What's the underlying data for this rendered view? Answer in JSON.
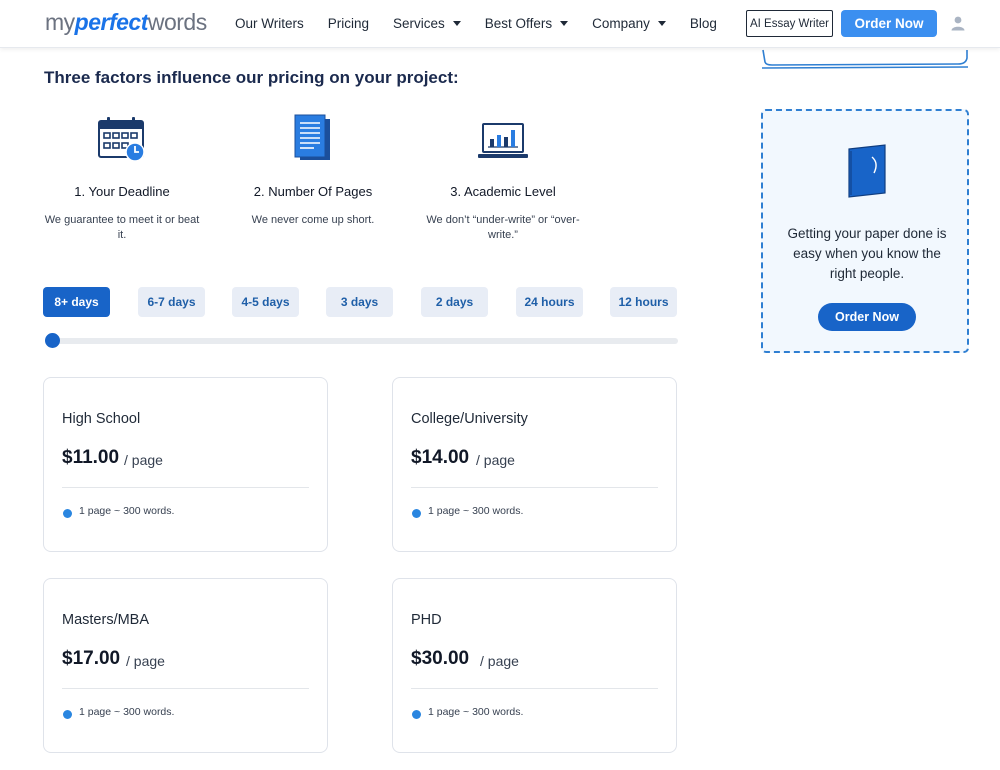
{
  "header": {
    "logo": {
      "part1": "my",
      "part2": "perfect",
      "part3": "words"
    },
    "nav": [
      {
        "label": "Our Writers",
        "dropdown": false
      },
      {
        "label": "Pricing",
        "dropdown": false
      },
      {
        "label": "Services",
        "dropdown": true
      },
      {
        "label": "Best Offers",
        "dropdown": true
      },
      {
        "label": "Company",
        "dropdown": true
      },
      {
        "label": "Blog",
        "dropdown": false
      }
    ],
    "ai_button": "AI Essay Writer",
    "order_button": "Order Now",
    "user_icon": "user-icon"
  },
  "main": {
    "title": "Three factors influence our pricing on your project:",
    "factors": [
      {
        "icon": "calendar-clock-icon",
        "title": "1. Your Deadline",
        "desc": "We guarantee to meet it or beat it."
      },
      {
        "icon": "document-pages-icon",
        "title": "2. Number Of Pages",
        "desc": "We never come up short."
      },
      {
        "icon": "laptop-chart-icon",
        "title": "3. Academic Level",
        "desc": "We don’t “under-write” or “over-write.”"
      }
    ],
    "deadlines": [
      "8+ days",
      "6-7 days",
      "4-5 days",
      "3 days",
      "2 days",
      "24 hours",
      "12 hours"
    ],
    "selected_deadline": "8+ days",
    "slider_value_fraction": 0,
    "cards": [
      {
        "level": "High School",
        "price": "$11.00",
        "unit": "/ page",
        "note": "1 page ~ 300 words."
      },
      {
        "level": "College/University",
        "price": "$14.00",
        "unit": "/ page",
        "note": "1 page ~ 300 words."
      },
      {
        "level": "Masters/MBA",
        "price": "$17.00",
        "unit": "/ page",
        "note": "1 page ~ 300 words."
      },
      {
        "level": "PHD",
        "price": "$30.00",
        "unit": "/ page",
        "note": "1 page ~ 300 words."
      }
    ]
  },
  "sidebar": {
    "promo_icon": "book-icon",
    "promo_text": "Getting your paper done is easy when you know the right people.",
    "promo_button": "Order Now"
  },
  "colors": {
    "primary": "#1864c8",
    "accent": "#3b8ff0",
    "heading": "#1b2a4e",
    "tab_bg": "#e8edf6",
    "promo_border": "#2f7fd2"
  }
}
